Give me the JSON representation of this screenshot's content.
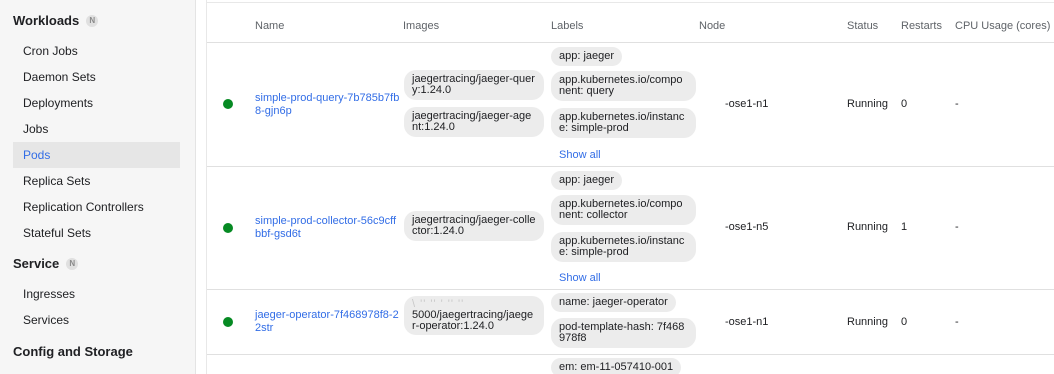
{
  "sidebar": {
    "workloads": {
      "title": "Workloads",
      "badge": "N"
    },
    "workload_items": [
      "Cron Jobs",
      "Daemon Sets",
      "Deployments",
      "Jobs",
      "Pods",
      "Replica Sets",
      "Replication Controllers",
      "Stateful Sets"
    ],
    "service": {
      "title": "Service",
      "badge": "N"
    },
    "service_items": [
      "Ingresses",
      "Services"
    ],
    "config": {
      "title": "Config and Storage"
    }
  },
  "table": {
    "headers": {
      "name": "Name",
      "images": "Images",
      "labels": "Labels",
      "node": "Node",
      "status": "Status",
      "restarts": "Restarts",
      "cpu": "CPU Usage (cores)"
    },
    "rows": [
      {
        "name": "simple-prod-query-7b785b7fb8-gjn6p",
        "images": [
          "jaegertracing/jaeger-query:1.24.0",
          "jaegertracing/jaeger-agent:1.24.0"
        ],
        "labels": [
          "app: jaeger",
          "app.kubernetes.io/component: query",
          "app.kubernetes.io/instance: simple-prod"
        ],
        "show_all": "Show all",
        "node": "-ose1-n1",
        "status": "Running",
        "restarts": "0",
        "cpu": "-",
        "status_color": "#068a23"
      },
      {
        "name": "simple-prod-collector-56c9cffbbf-gsd6t",
        "images": [
          "jaegertracing/jaeger-collector:1.24.0"
        ],
        "labels": [
          "app: jaeger",
          "app.kubernetes.io/component: collector",
          "app.kubernetes.io/instance: simple-prod"
        ],
        "show_all": "Show all",
        "node": "-ose1-n5",
        "status": "Running",
        "restarts": "1",
        "cpu": "-",
        "status_color": "#068a23"
      },
      {
        "name": "jaeger-operator-7f468978f8-22str",
        "image_obscured": "\\ '' '' ' '' ''",
        "images": [
          "5000/jaegertracing/jaeger-operator:1.24.0"
        ],
        "labels": [
          "name: jaeger-operator",
          "pod-template-hash: 7f468978f8"
        ],
        "node": "-ose1-n1",
        "status": "Running",
        "restarts": "0",
        "cpu": "-",
        "status_color": "#068a23"
      },
      {
        "labels": [
          "em: em-11-057410-001"
        ]
      }
    ]
  },
  "colors": {
    "accent": "#326de6",
    "running": "#068a23"
  }
}
